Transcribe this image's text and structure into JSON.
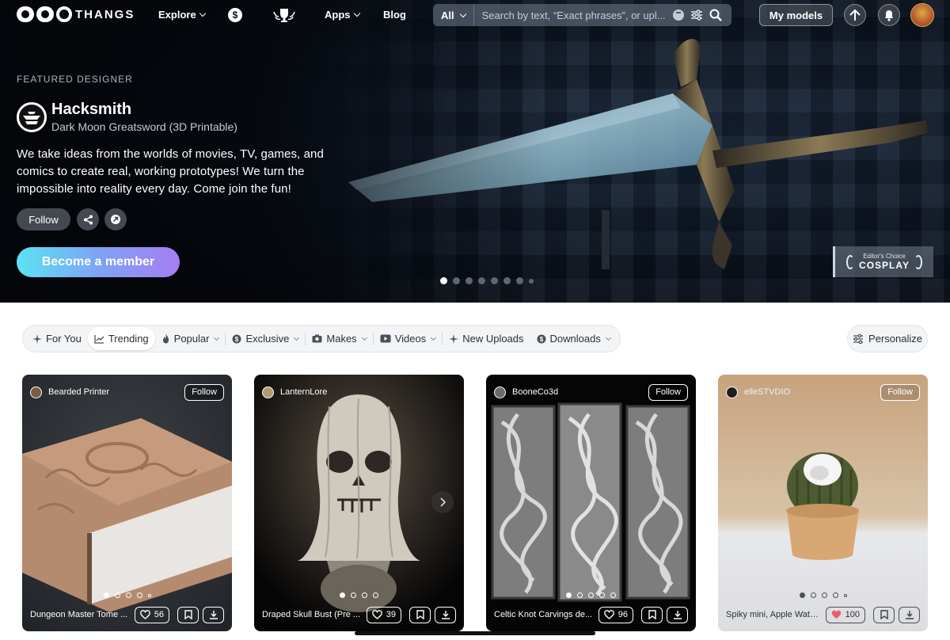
{
  "nav": {
    "brand": "THANGS",
    "links": {
      "explore": "Explore",
      "apps": "Apps",
      "blog": "Blog"
    },
    "search": {
      "scope": "All",
      "placeholder": "Search by text, “Exact phrases”, or upl..."
    },
    "my_models": "My models",
    "icons": [
      "dollar-coin-icon",
      "trophy-icon",
      "upload-icon",
      "bell-icon"
    ]
  },
  "hero": {
    "label": "FEATURED DESIGNER",
    "designer_name": "Hacksmith",
    "model_name": "Dark Moon Greatsword (3D Printable)",
    "bio": "We take ideas from the worlds of movies, TV, games, and comics to create real, working prototypes! We turn the impossible into reality every day. Come join the fun!",
    "follow": "Follow",
    "cta": "Become a member",
    "badge": {
      "small": "Editor's Choice",
      "big": "COSPLAY"
    },
    "slides": 8,
    "active_slide": 1
  },
  "filters": {
    "chips": [
      {
        "label": "For You",
        "icon": "sparkle-icon"
      },
      {
        "label": "Trending",
        "icon": "trending-icon",
        "active": true
      },
      {
        "label": "Popular",
        "icon": "flame-icon",
        "dropdown": true
      },
      {
        "label": "Exclusive",
        "icon": "dollar-coin-icon",
        "dropdown": true
      },
      {
        "label": "Makes",
        "icon": "camera-icon",
        "dropdown": true
      },
      {
        "label": "Videos",
        "icon": "video-icon",
        "dropdown": true
      },
      {
        "label": "New Uploads",
        "icon": "sparkle-icon"
      },
      {
        "label": "Downloads",
        "icon": "download-coin-icon",
        "dropdown": true
      }
    ],
    "personalize": "Personalize"
  },
  "cards": [
    {
      "author": "Bearded Printer",
      "follow": "Follow",
      "title": "Dungeon Master Tome ...",
      "likes": "56",
      "liked": false
    },
    {
      "author": "LanternLore",
      "follow": "",
      "title": "Draped Skull Bust (Pre ...",
      "likes": "39",
      "liked": false
    },
    {
      "author": "BooneCo3d",
      "follow": "Follow",
      "title": "Celtic Knot Carvings de...",
      "likes": "96",
      "liked": false
    },
    {
      "author": "elleSTVDIO",
      "follow": "Follow",
      "title": "Spiky mini, Apple Watc...",
      "likes": "100",
      "liked": true
    }
  ],
  "colors": {
    "accent_from": "#5be3f2",
    "accent_to": "#a77df3",
    "liked_heart": "#ef5a6f"
  }
}
